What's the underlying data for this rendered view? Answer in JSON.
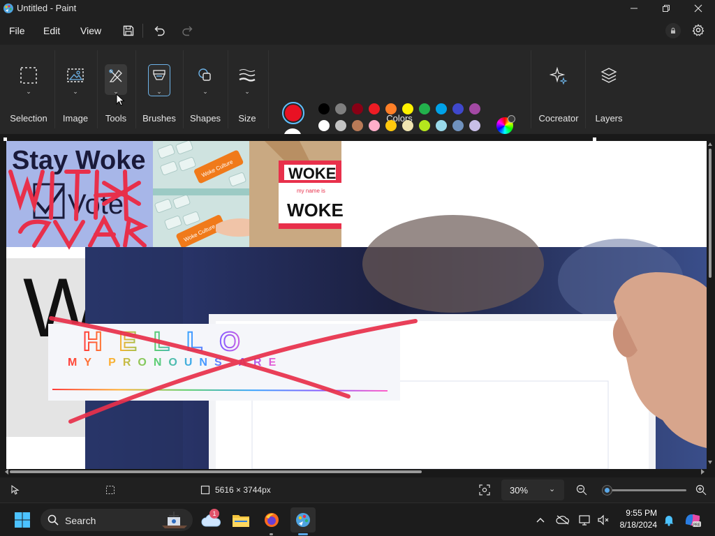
{
  "window": {
    "title": "Untitled - Paint"
  },
  "menu": {
    "file": "File",
    "edit": "Edit",
    "view": "View"
  },
  "ribbon": {
    "groups": [
      {
        "key": "selection",
        "label": "Selection"
      },
      {
        "key": "image",
        "label": "Image"
      },
      {
        "key": "tools",
        "label": "Tools"
      },
      {
        "key": "brushes",
        "label": "Brushes"
      },
      {
        "key": "shapes",
        "label": "Shapes"
      },
      {
        "key": "size",
        "label": "Size"
      },
      {
        "key": "colors",
        "label": "Colors"
      },
      {
        "key": "cocreator",
        "label": "Cocreator"
      },
      {
        "key": "layers",
        "label": "Layers"
      }
    ],
    "primary_color": "#e81123",
    "secondary_color": "#ffffff",
    "palette_row1": [
      "#000000",
      "#7f7f7f",
      "#880015",
      "#ed1c24",
      "#ff7f27",
      "#fff200",
      "#22b14c",
      "#00a2e8",
      "#3f48cc",
      "#a349a4"
    ],
    "palette_row2": [
      "#ffffff",
      "#c3c3c3",
      "#b97a57",
      "#ffaec9",
      "#ffc90e",
      "#efe4b0",
      "#b5e61d",
      "#99d9ea",
      "#7092be",
      "#c8bfe7"
    ],
    "custom_slots": 10
  },
  "canvas": {
    "texts": {
      "stay_woke": "Stay Woke",
      "vote": "Vote",
      "woke_top": "WOKE",
      "my_name_is": "my name is",
      "woke_bottom": "WOKE",
      "key_label_1": "Woke Culture",
      "key_label_2": "Woke Culture",
      "hello": "HELLO",
      "pronouns": "MY PRONOUNS ARE",
      "big_letter": "W"
    }
  },
  "status": {
    "dimensions": "5616 × 3744px",
    "zoom": "30%",
    "zoom_fraction": 0.03
  },
  "taskbar": {
    "search": "Search",
    "weather_badge": "1",
    "time": "9:55 PM",
    "date": "8/18/2024"
  }
}
